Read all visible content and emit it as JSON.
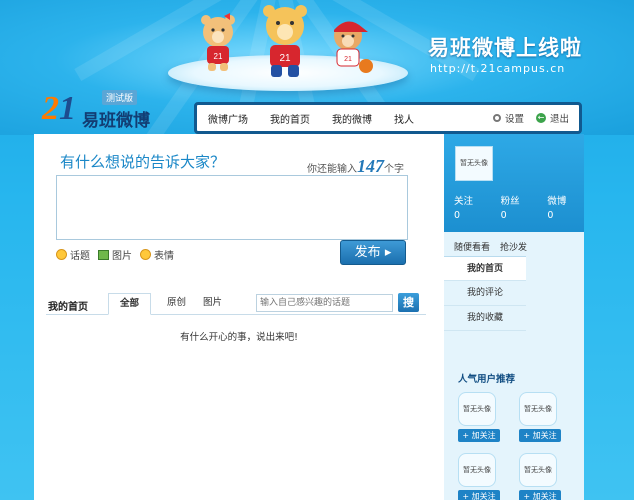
{
  "banner": {
    "title": "易班微博上线啦",
    "url": "http://t.21campus.cn"
  },
  "logo": {
    "mark": "21",
    "text": "易班微博",
    "badge": "测试版"
  },
  "nav": {
    "items": [
      "微博广场",
      "我的首页",
      "我的微博",
      "找人"
    ],
    "settings": "设置",
    "logout": "退出"
  },
  "compose": {
    "prompt": "有什么想说的告诉大家？",
    "counter_prefix": "你还能输入",
    "counter_value": "147",
    "counter_suffix": "个字",
    "tools": [
      "话题",
      "图片",
      "表情"
    ],
    "publish": "发布"
  },
  "feed": {
    "section_title": "我的首页",
    "tabs": [
      "全部",
      "原创",
      "图片"
    ],
    "active_tab": "全部",
    "topic_placeholder": "输入自己感兴趣的话题",
    "search_button": "搜",
    "empty_message": "有什么开心的事，说出来吧!"
  },
  "sidebar": {
    "avatar_label": "暂无头像",
    "stats": [
      {
        "label": "关注",
        "value": "0"
      },
      {
        "label": "粉丝",
        "value": "0"
      },
      {
        "label": "微博",
        "value": "0"
      }
    ],
    "tabs": [
      "随便看看",
      "抢沙发"
    ],
    "menu": [
      "我的首页",
      "我的评论",
      "我的收藏"
    ],
    "active_menu": "我的首页",
    "popular_title": "人气用户推荐",
    "recommended": [
      {
        "avatar": "暂无头像",
        "follow": "加关注"
      },
      {
        "avatar": "暂无头像",
        "follow": "加关注"
      },
      {
        "avatar": "暂无头像",
        "follow": "加关注"
      },
      {
        "avatar": "暂无头像",
        "follow": "加关注"
      }
    ]
  },
  "colors": {
    "background": "#27b6ee",
    "accent": "#1a87c7",
    "nav_border": "#11598f",
    "logo_orange": "#ff7a00"
  }
}
